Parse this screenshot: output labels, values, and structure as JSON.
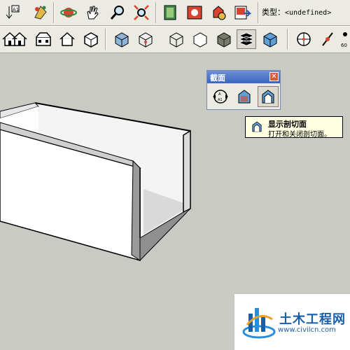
{
  "toolbar_top": {
    "type_label": "类型：",
    "type_value": "<undefined>",
    "icons": [
      "axes-text-icon",
      "paint-bucket-icon",
      "orbit-icon",
      "pan-hand-icon",
      "zoom-icon",
      "zoom-extents-icon",
      "map-book-icon",
      "warehouse-icon",
      "components-icon",
      "export-icon"
    ]
  },
  "toolbar_views": {
    "icons": [
      "home-icon",
      "front-view-icon",
      "right-view-icon",
      "back-view-icon",
      "iso-cube-icon",
      "wireframe-icon",
      "hidden-line-icon",
      "shaded-icon",
      "shaded-texture-icon",
      "monochrome-icon",
      "xray-icon",
      "walk-icon",
      "position-camera-icon",
      "look-around-icon"
    ]
  },
  "section_panel": {
    "title": "截面",
    "close_label": "✕",
    "buttons": [
      "section-plane-icon",
      "display-section-planes-icon",
      "display-section-cuts-icon"
    ]
  },
  "tooltip": {
    "title": "显示剖切面",
    "description": "打开和关闭剖切面。"
  },
  "watermark": {
    "site_name": "土木工程网",
    "url": "www.civilcn.com"
  },
  "colors": {
    "toolbar_bg": "#ecebe3",
    "viewport_bg": "#c9cac4",
    "panel_title": "#3a64bf",
    "tooltip_bg": "#ffffe1",
    "watermark_blue": "#1a5ea8"
  }
}
